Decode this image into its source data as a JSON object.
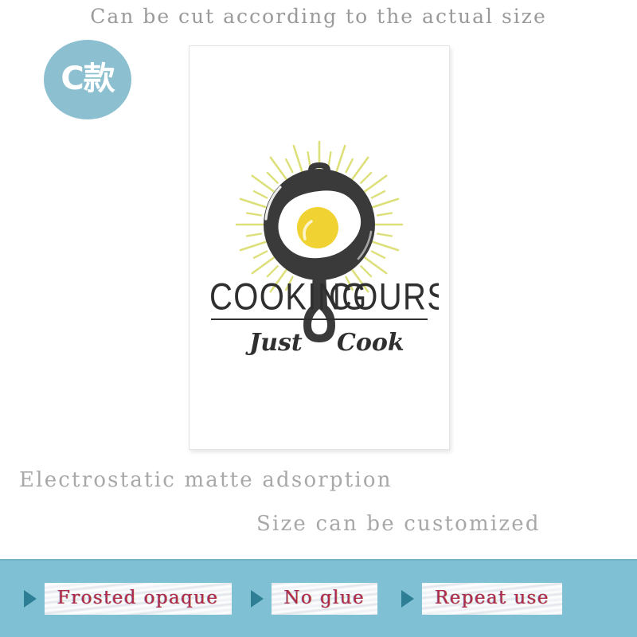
{
  "header": {
    "caption": "Can be cut according to the actual size"
  },
  "badge": {
    "label": "C款",
    "color": "#8cc0d0",
    "text_color": "#ffffff"
  },
  "poster": {
    "logo": {
      "title": "COOKING COURSES",
      "tagline": "Just Cook",
      "icon_name": "frying-pan-with-fried-egg",
      "colors": {
        "pan": "#3a3a3a",
        "yolk": "#f0d332",
        "egg_white": "#ffffff",
        "rays": "#dde07a",
        "text": "#2f2f2f"
      }
    },
    "background": "#ffffff"
  },
  "captions": {
    "electrostatic": "Electrostatic matte adsorption",
    "size": "Size can be customized"
  },
  "banner": {
    "background": "#7fc0d4",
    "arrow_color": "#2e7f96",
    "text_color": "#b22a4a",
    "features": [
      {
        "label": "Frosted opaque"
      },
      {
        "label": "No glue"
      },
      {
        "label": "Repeat use"
      }
    ]
  }
}
